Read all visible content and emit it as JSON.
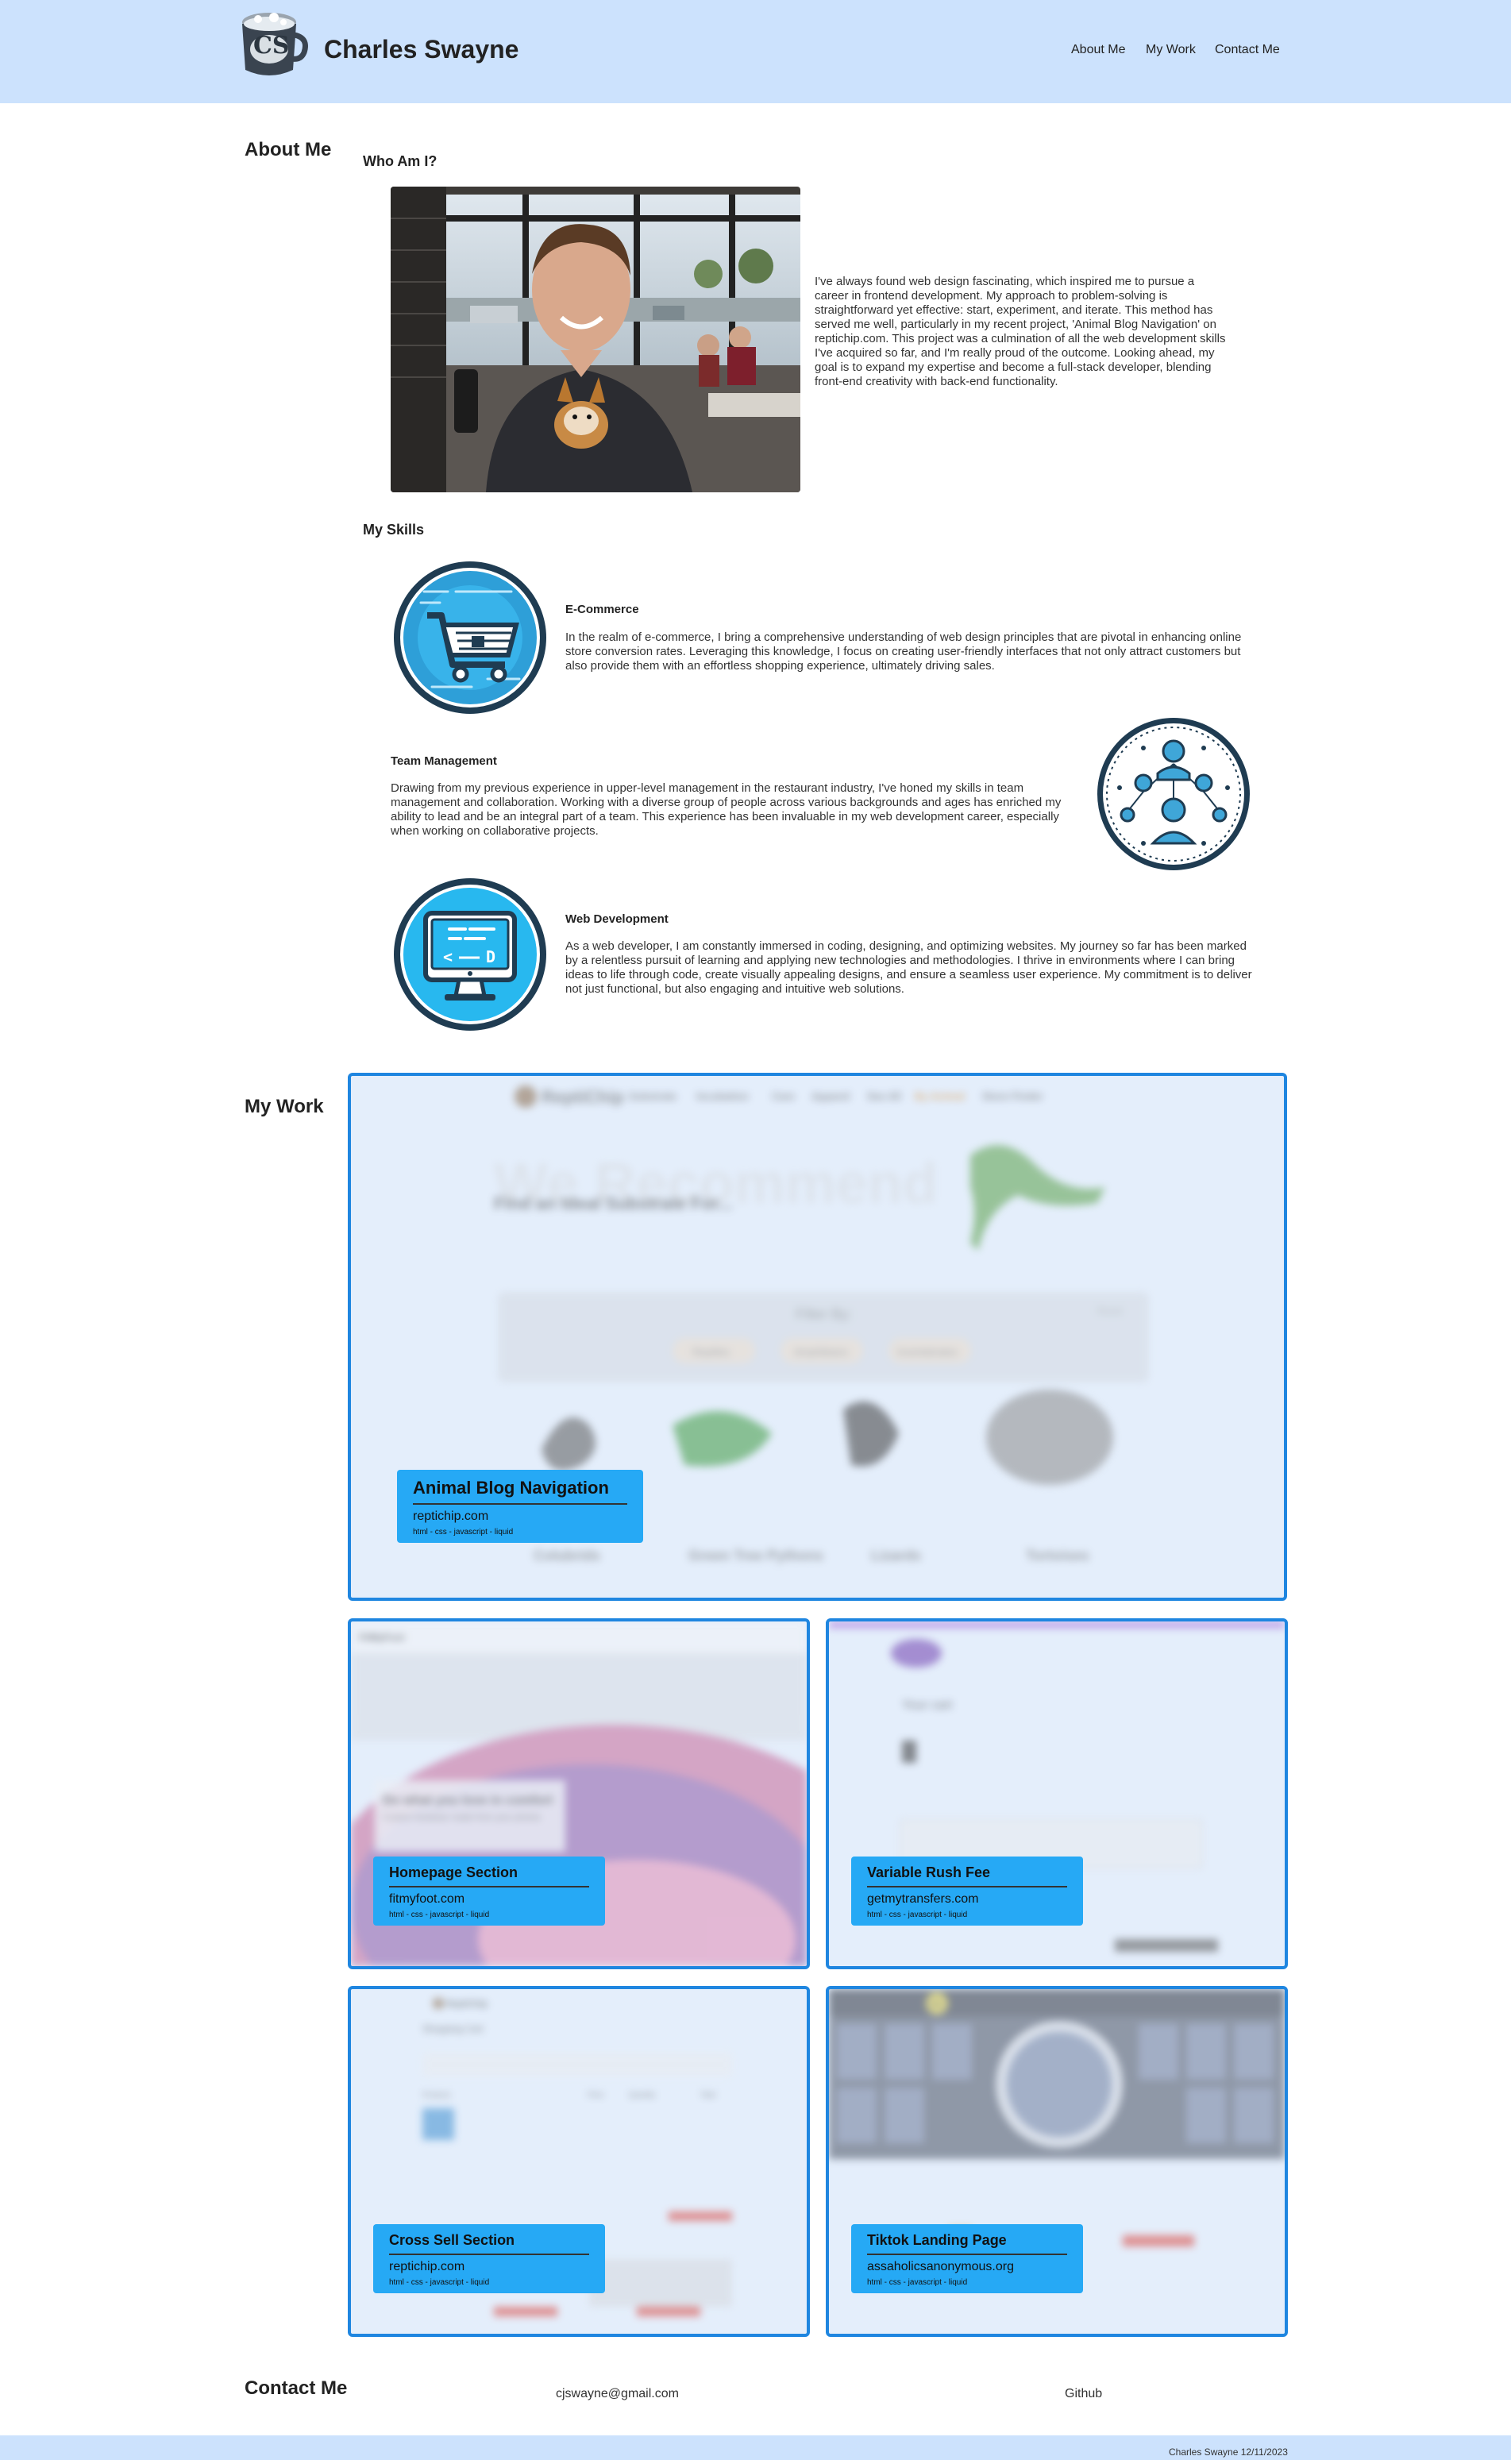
{
  "header": {
    "logo_text": "CS",
    "title": "Charles Swayne",
    "nav": [
      "About Me",
      "My Work",
      "Contact Me"
    ]
  },
  "about": {
    "heading": "About Me",
    "who_heading": "Who Am I?",
    "bio": "I've always found web design fascinating, which inspired me to pursue a career in frontend development. My approach to problem-solving is straightforward yet effective: start, experiment, and iterate. This method has served me well, particularly in my recent project, 'Animal Blog Navigation' on reptichip.com. This project was a culmination of all the web development skills I've acquired so far, and I'm really proud of the outcome. Looking ahead, my goal is to expand my expertise and become a full-stack developer, blending front-end creativity with back-end functionality."
  },
  "skills": {
    "heading": "My Skills",
    "items": [
      {
        "title": "E-Commerce",
        "text": "In the realm of e-commerce, I bring a comprehensive understanding of web design principles that are pivotal in enhancing online store conversion rates. Leveraging this knowledge, I focus on creating user-friendly interfaces that not only attract customers but also provide them with an effortless shopping experience, ultimately driving sales.",
        "icon": "shopping-cart-icon"
      },
      {
        "title": "Team Management",
        "text": "Drawing from my previous experience in upper-level management in the restaurant industry, I've honed my skills in team management and collaboration. Working with a diverse group of people across various backgrounds and ages has enriched my ability to lead and be an integral part of a team. This experience has been invaluable in my web development career, especially when working on collaborative projects.",
        "icon": "team-network-icon"
      },
      {
        "title": "Web Development",
        "text": "As a web developer, I am constantly immersed in coding, designing, and optimizing websites. My journey so far has been marked by a relentless pursuit of learning and applying new technologies and methodologies. I thrive in environments where I can bring ideas to life through code, create visually appealing designs, and ensure a seamless user experience. My commitment is to deliver not just functional, but also engaging and intuitive web solutions.",
        "icon": "monitor-code-icon"
      }
    ]
  },
  "work": {
    "heading": "My Work",
    "projects": [
      {
        "title": "Animal Blog Navigation",
        "site": "reptichip.com",
        "tech": "html - css - javascript - liquid"
      },
      {
        "title": "Homepage Section",
        "site": "fitmyfoot.com",
        "tech": "html - css - javascript - liquid"
      },
      {
        "title": "Variable Rush Fee",
        "site": "getmytransfers.com",
        "tech": "html - css - javascript - liquid"
      },
      {
        "title": "Cross Sell Section",
        "site": "reptichip.com",
        "tech": "html - css - javascript - liquid"
      },
      {
        "title": "Tiktok Landing Page",
        "site": "assaholicsanonymous.org",
        "tech": "html - css - javascript - liquid"
      }
    ],
    "preview1": {
      "brand": "ReptiChip",
      "nav": [
        "Substrate",
        "Incubation",
        "Care",
        "Apparel",
        "See All",
        "By Animal",
        "Store Finder"
      ],
      "bg_text": "We Recommend",
      "headline": "Find an Ideal Substrate For...",
      "filter_title": "Filter By:",
      "filter_reset": "Reset",
      "filters": [
        "Reptiles",
        "Amphibians",
        "Invertebrates"
      ],
      "animals": [
        "Colubrids",
        "Green Tree Pythons",
        "Lizards",
        "Tortoises"
      ]
    },
    "preview2": {
      "brand": "FitMyFoot",
      "headline": "Do what you love in comfort",
      "sub": "Custom footwear made from your photos"
    },
    "preview3": {
      "headline": "Your cart"
    },
    "preview4": {
      "brand": "ReptiChip",
      "headline": "Shopping Cart",
      "columns": [
        "Products",
        "Price",
        "Quantity",
        "Total"
      ]
    },
    "preview5": {
      "brand": "AA"
    }
  },
  "contact": {
    "heading": "Contact Me",
    "email": "cjswayne@gmail.com",
    "github": "Github"
  },
  "footer": {
    "text": "Charles Swayne 12/11/2023"
  },
  "colors": {
    "header_bg": "#cce2fd",
    "card_border": "#1f86e0",
    "label_bg": "#26a9f5"
  }
}
